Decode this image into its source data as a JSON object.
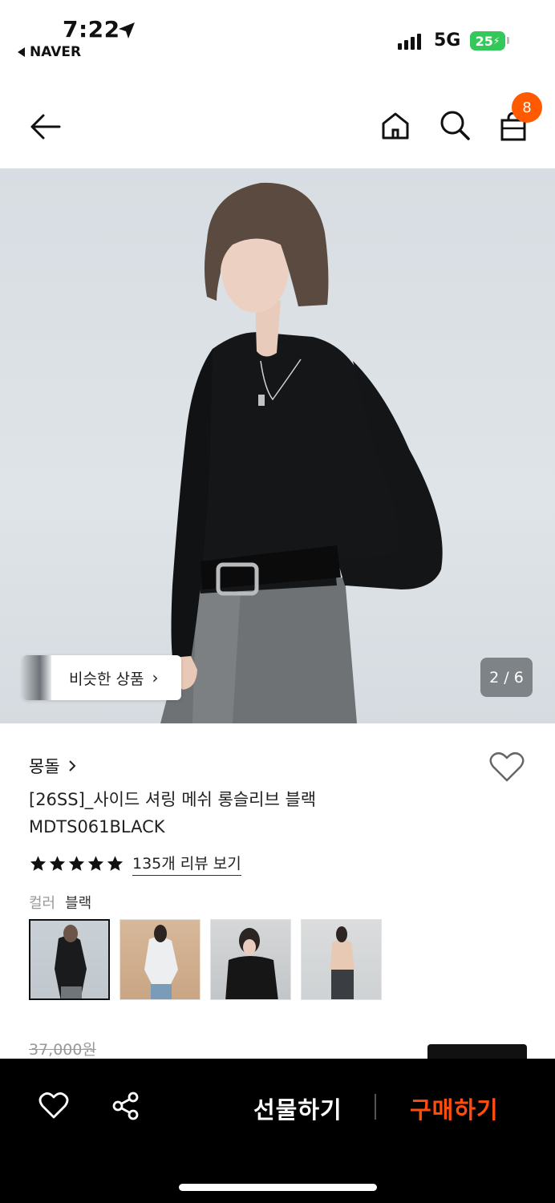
{
  "status_bar": {
    "time": "7:22",
    "back_app": "NAVER",
    "network": "5G",
    "battery": "25"
  },
  "nav": {
    "cart_count": "8",
    "icons": [
      "back-arrow-icon",
      "home-icon",
      "search-icon",
      "shopping-bag-icon"
    ]
  },
  "gallery": {
    "similar_label": "비슷한 상품",
    "page_counter": "2 / 6",
    "current_page": 2,
    "total_pages": 6
  },
  "product": {
    "brand": "몽돌",
    "title_line1": "[26SS]_사이드 셔링 메쉬 롱슬리브 블랙",
    "title_line2": "MDTS061BLACK",
    "rating_stars": 5,
    "review_link": "135개 리뷰 보기",
    "color_label": "컬러",
    "color_value": "블랙",
    "old_price": "37,000원"
  },
  "bottom_bar": {
    "gift_label": "선물하기",
    "buy_label": "구매하기"
  },
  "colors": {
    "accent": "#ff5a00",
    "buy": "#ff4d0d",
    "bar_bg": "#000000"
  }
}
